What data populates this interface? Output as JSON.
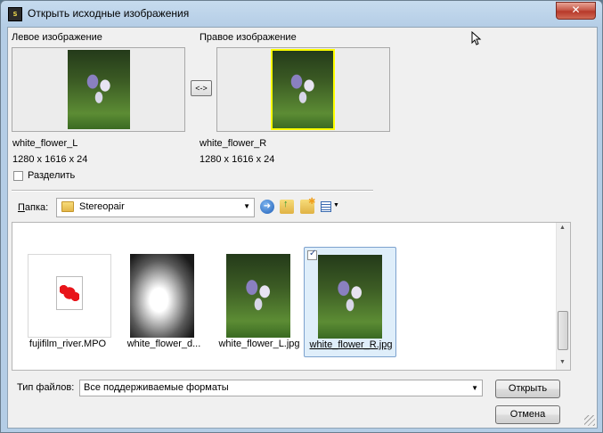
{
  "window": {
    "title": "Открыть исходные изображения",
    "icon_label": "S",
    "close_glyph": "✕"
  },
  "left_image": {
    "header": "Левое изображение",
    "name": "white_flower_L",
    "size": "1280 x 1616 x 24"
  },
  "right_image": {
    "header": "Правое изображение",
    "name": "white_flower_R",
    "size": "1280 x 1616 x 24"
  },
  "swap_button": {
    "label": "<->"
  },
  "split_checkbox": {
    "label": "Разделить",
    "checked": false
  },
  "folder": {
    "label": "Папка:",
    "current": "Stereopair"
  },
  "toolbar_icons": [
    "back-icon",
    "up-folder-icon",
    "new-folder-icon",
    "view-menu-icon"
  ],
  "files": [
    {
      "name": "fujifilm_river.MPO",
      "kind": "generic",
      "selected": false,
      "checked": false
    },
    {
      "name": "white_flower_d...",
      "kind": "depth",
      "selected": false,
      "checked": false
    },
    {
      "name": "white_flower_L.jpg",
      "kind": "photo",
      "selected": false,
      "checked": false
    },
    {
      "name": "white_flower_R.jpg",
      "kind": "photo",
      "selected": true,
      "checked": true
    }
  ],
  "file_type": {
    "label": "Тип файлов:",
    "value": "Все поддерживаемые форматы"
  },
  "buttons": {
    "open": "Открыть",
    "cancel": "Отмена"
  },
  "colors": {
    "selection_border": "#7da2ce",
    "right_preview_highlight": "#ffff00"
  }
}
